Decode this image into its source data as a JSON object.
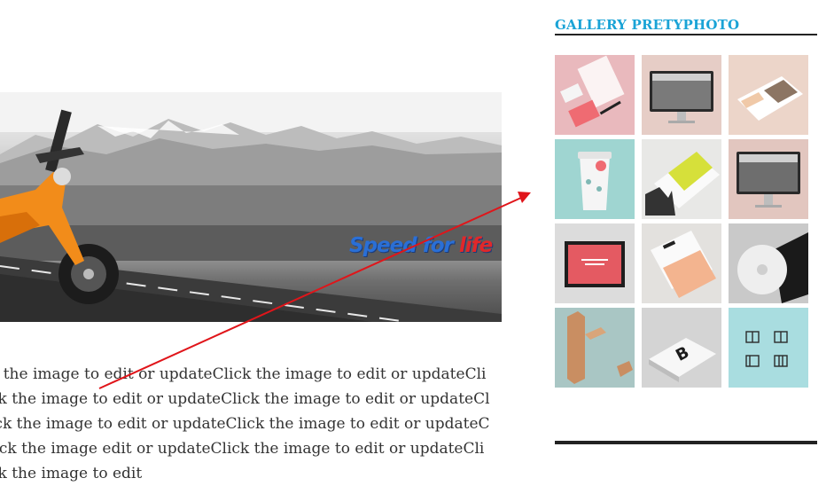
{
  "banner": {
    "alt": "Motorcycle on mountain road banner",
    "tagline_part1": "Speed for ",
    "tagline_part2": "life"
  },
  "content": {
    "paragraph": "k the image to edit or updateClick the image to edit or updateClick the image to edit or updateClick the image to edit or updateClick the image to edit or updateClick the image to edit or updateClick the image edit or updateClick the image to edit or updateClick the image to edit"
  },
  "sidebar": {
    "gallery_title": "GALLERY PRETYPHOTO",
    "thumbnails": [
      {
        "name": "stationery-mockup-thumb",
        "bg": "#e9b9bd"
      },
      {
        "name": "desktop-monitor-thumb",
        "bg": "#e6cdc6"
      },
      {
        "name": "magazine-mockup-thumb",
        "bg": "#ecd5c9"
      },
      {
        "name": "coffee-cup-thumb",
        "bg": "#9fd5d1"
      },
      {
        "name": "yellow-folder-thumb",
        "bg": "#e8e8e6"
      },
      {
        "name": "desktop-monitor-2-thumb",
        "bg": "#e2c6bf"
      },
      {
        "name": "artwork-frame-thumb",
        "bg": "#dcdcdc"
      },
      {
        "name": "berlin-card-thumb",
        "bg": "#e3e1de"
      },
      {
        "name": "cd-disc-thumb",
        "bg": "#c9c9c9"
      },
      {
        "name": "wooden-letter-thumb",
        "bg": "#a9c6c4"
      },
      {
        "name": "business-cards-thumb",
        "bg": "#d4d4d4"
      },
      {
        "name": "book-icons-thumb",
        "bg": "#a9dde0"
      }
    ]
  },
  "colors": {
    "accent": "#1aa3d6",
    "arrow": "#e0151a"
  }
}
